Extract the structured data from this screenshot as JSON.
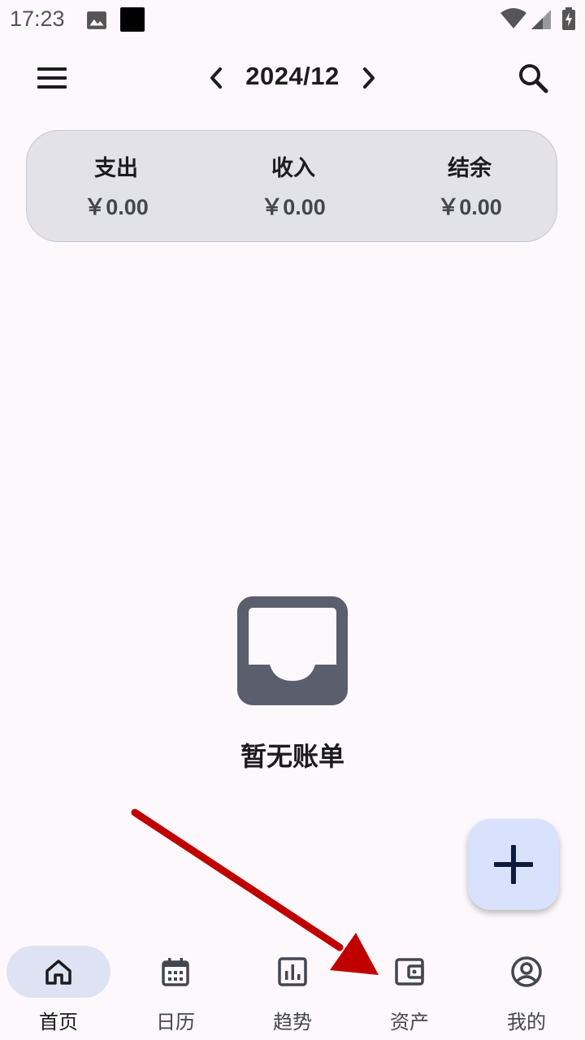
{
  "status_bar": {
    "time": "17:23",
    "icons": [
      "image-icon",
      "black-square-icon",
      "wifi-icon",
      "signal-icon",
      "battery-icon"
    ]
  },
  "app_bar": {
    "title": "2024/12",
    "icons": [
      "menu-icon",
      "chevron-left-icon",
      "chevron-right-icon",
      "search-icon"
    ]
  },
  "summary": {
    "expense_label": "支出",
    "expense_value": "￥0.00",
    "income_label": "收入",
    "income_value": "￥0.00",
    "balance_label": "结余",
    "balance_value": "￥0.00"
  },
  "empty_state": {
    "icon": "inbox-icon",
    "text": "暂无账单"
  },
  "fab": {
    "icon": "plus-icon"
  },
  "bottom_nav": {
    "items": [
      {
        "label": "首页",
        "icon": "home-icon",
        "active": true
      },
      {
        "label": "日历",
        "icon": "calendar-icon",
        "active": false
      },
      {
        "label": "趋势",
        "icon": "chart-icon",
        "active": false
      },
      {
        "label": "资产",
        "icon": "wallet-icon",
        "active": false
      },
      {
        "label": "我的",
        "icon": "account-icon",
        "active": false
      }
    ]
  },
  "colors": {
    "background": "#fcf8fc",
    "card": "#e2e2e8",
    "fab": "#d8e2fd",
    "nav_indicator": "#dde3f2",
    "annotation_arrow": "#cc0000",
    "icon": "#44464f"
  }
}
